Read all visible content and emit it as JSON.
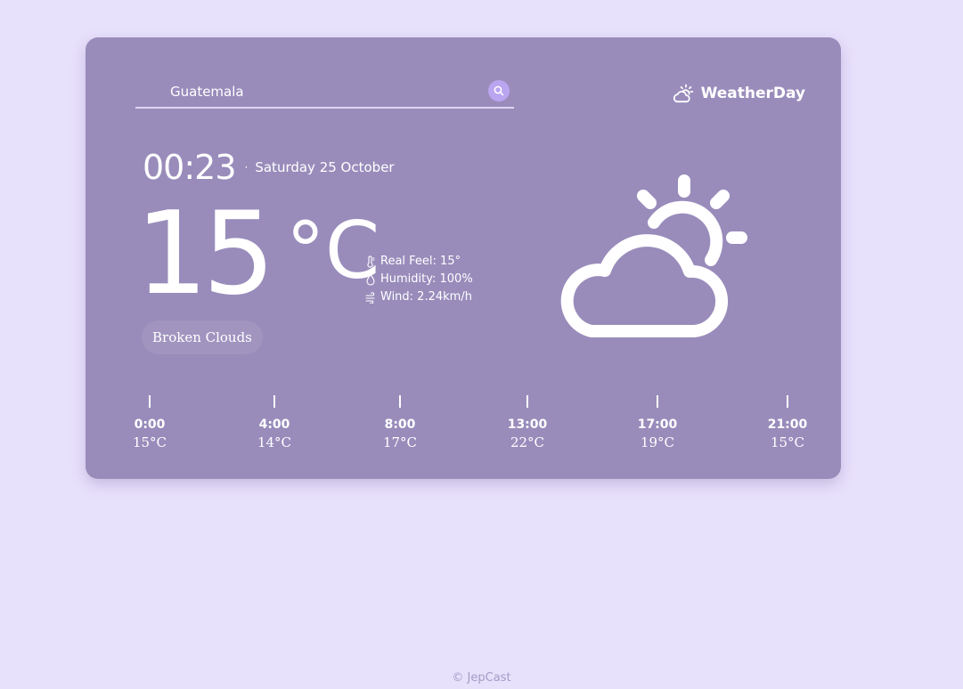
{
  "search": {
    "value": "Guatemala",
    "placeholder": ""
  },
  "brand": {
    "name": "WeatherDay"
  },
  "clock": {
    "time": "00:23",
    "separator": "·",
    "date": "Saturday 25 October"
  },
  "current": {
    "temp": "15",
    "unit": "°C",
    "real_feel": "Real Feel: 15°",
    "humidity": "Humidity: 100%",
    "wind": "Wind: 2.24km/h",
    "condition": "Broken Clouds",
    "icon": "partly-cloudy-icon"
  },
  "forecast": [
    {
      "time": "0:00",
      "temp": "15°C"
    },
    {
      "time": "4:00",
      "temp": "14°C"
    },
    {
      "time": "8:00",
      "temp": "17°C"
    },
    {
      "time": "13:00",
      "temp": "22°C"
    },
    {
      "time": "17:00",
      "temp": "19°C"
    },
    {
      "time": "21:00",
      "temp": "15°C"
    }
  ],
  "footer": {
    "text": "© JepCast"
  },
  "colors": {
    "background": "#e8e1fc",
    "card": "#998cbb",
    "accent": "#b9a5f0"
  }
}
